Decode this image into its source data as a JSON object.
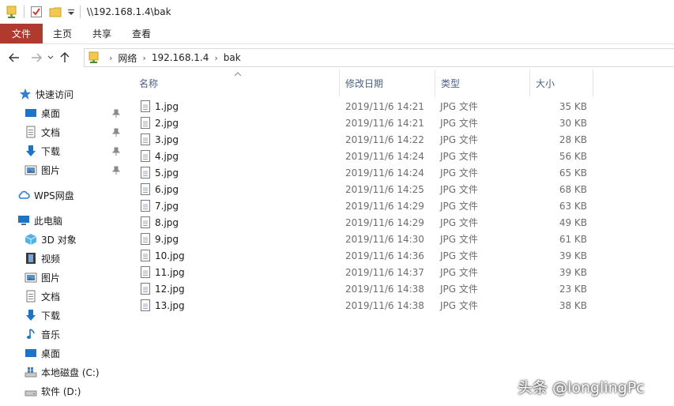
{
  "titlebar": {
    "path": "\\\\192.168.1.4\\bak"
  },
  "ribbon": {
    "tabs": [
      "文件",
      "主页",
      "共享",
      "查看"
    ]
  },
  "address": {
    "crumbs": [
      "网络",
      "192.168.1.4",
      "bak"
    ]
  },
  "navpane": {
    "quick_access": "快速访问",
    "quick_items": [
      "桌面",
      "文档",
      "下载",
      "图片"
    ],
    "wps": "WPS网盘",
    "this_pc": "此电脑",
    "pc_items": [
      "3D 对象",
      "视频",
      "图片",
      "文档",
      "下载",
      "音乐",
      "桌面",
      "本地磁盘 (C:)",
      "软件 (D:)"
    ]
  },
  "columns": {
    "name": "名称",
    "date": "修改日期",
    "type": "类型",
    "size": "大小"
  },
  "files": [
    {
      "name": "1.jpg",
      "date": "2019/11/6 14:21",
      "type": "JPG 文件",
      "size": "35 KB"
    },
    {
      "name": "2.jpg",
      "date": "2019/11/6 14:21",
      "type": "JPG 文件",
      "size": "30 KB"
    },
    {
      "name": "3.jpg",
      "date": "2019/11/6 14:22",
      "type": "JPG 文件",
      "size": "28 KB"
    },
    {
      "name": "4.jpg",
      "date": "2019/11/6 14:24",
      "type": "JPG 文件",
      "size": "56 KB"
    },
    {
      "name": "5.jpg",
      "date": "2019/11/6 14:24",
      "type": "JPG 文件",
      "size": "65 KB"
    },
    {
      "name": "6.jpg",
      "date": "2019/11/6 14:25",
      "type": "JPG 文件",
      "size": "68 KB"
    },
    {
      "name": "7.jpg",
      "date": "2019/11/6 14:29",
      "type": "JPG 文件",
      "size": "63 KB"
    },
    {
      "name": "8.jpg",
      "date": "2019/11/6 14:29",
      "type": "JPG 文件",
      "size": "49 KB"
    },
    {
      "name": "9.jpg",
      "date": "2019/11/6 14:30",
      "type": "JPG 文件",
      "size": "61 KB"
    },
    {
      "name": "10.jpg",
      "date": "2019/11/6 14:36",
      "type": "JPG 文件",
      "size": "39 KB"
    },
    {
      "name": "11.jpg",
      "date": "2019/11/6 14:37",
      "type": "JPG 文件",
      "size": "39 KB"
    },
    {
      "name": "12.jpg",
      "date": "2019/11/6 14:38",
      "type": "JPG 文件",
      "size": "23 KB"
    },
    {
      "name": "13.jpg",
      "date": "2019/11/6 14:38",
      "type": "JPG 文件",
      "size": "38 KB"
    }
  ],
  "watermark": "头条 @longlingPc",
  "colors": {
    "file_tab": "#b03a2e",
    "header_text": "#4d6082",
    "folder": "#f2c94c",
    "accent_blue": "#1e73c8"
  }
}
